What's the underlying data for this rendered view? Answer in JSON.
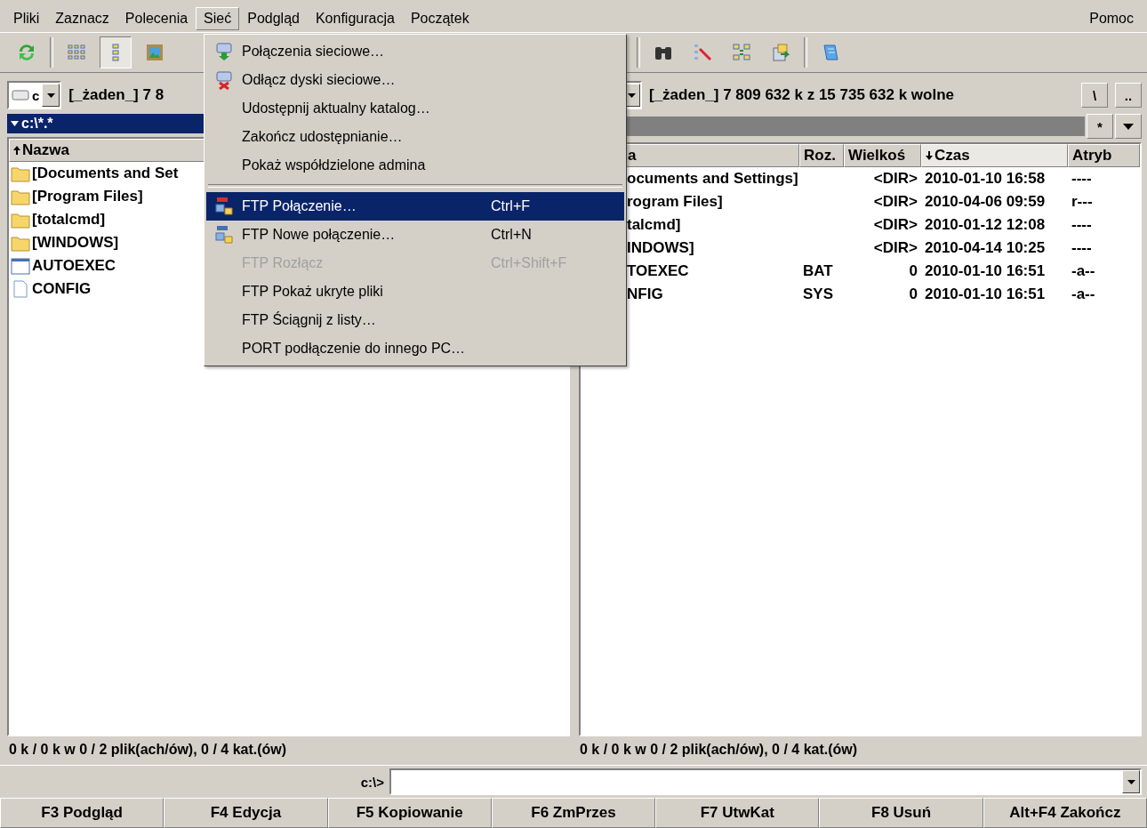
{
  "menu_bar": {
    "items": [
      {
        "label": "Pliki",
        "selected": false
      },
      {
        "label": "Zaznacz",
        "selected": false
      },
      {
        "label": "Polecenia",
        "selected": false
      },
      {
        "label": "Sieć",
        "selected": true
      },
      {
        "label": "Podgląd",
        "selected": false
      },
      {
        "label": "Konfiguracja",
        "selected": false
      },
      {
        "label": "Początek",
        "selected": false
      }
    ],
    "help": {
      "label": "Pomoc",
      "selected": false
    }
  },
  "toolbar": {
    "left": [
      {
        "kind": "refresh",
        "selected": false
      },
      {
        "kind": "separator"
      },
      {
        "kind": "brief",
        "selected": false
      },
      {
        "kind": "detailed",
        "selected": true
      },
      {
        "kind": "thumbnails",
        "selected": false
      }
    ],
    "right": [
      {
        "kind": "separator"
      },
      {
        "kind": "search",
        "selected": false
      },
      {
        "kind": "rename",
        "selected": false
      },
      {
        "kind": "sync",
        "selected": false
      },
      {
        "kind": "copy",
        "selected": false
      },
      {
        "kind": "separator"
      },
      {
        "kind": "notepad",
        "selected": false
      }
    ]
  },
  "dropdown": [
    {
      "kind": "connect",
      "label": "Połączenia sieciowe…",
      "disabled": false,
      "selected": false
    },
    {
      "kind": "disconnect",
      "label": "Odłącz dyski sieciowe…",
      "disabled": false,
      "selected": false
    },
    {
      "kind": "plain",
      "label": "Udostępnij aktualny katalog…",
      "disabled": false,
      "selected": false
    },
    {
      "kind": "plain",
      "label": "Zakończ udostępnianie…",
      "disabled": false,
      "selected": false
    },
    {
      "kind": "plain",
      "label": "Pokaż współdzielone admina",
      "disabled": false,
      "selected": false
    },
    {
      "kind": "separator"
    },
    {
      "kind": "ftp",
      "label": "FTP Połączenie…",
      "shortcut": "Ctrl+F",
      "disabled": false,
      "selected": true
    },
    {
      "kind": "url",
      "label": "FTP Nowe połączenie…",
      "shortcut": "Ctrl+N",
      "disabled": false,
      "selected": false
    },
    {
      "kind": "plain",
      "label": "FTP Rozłącz",
      "shortcut": "Ctrl+Shift+F",
      "disabled": true,
      "selected": false
    },
    {
      "kind": "plain",
      "label": "FTP Pokaż ukryte pliki",
      "disabled": false,
      "selected": false
    },
    {
      "kind": "plain",
      "label": "FTP Ściągnij z listy…",
      "disabled": false,
      "selected": false
    },
    {
      "kind": "plain",
      "label": "PORT podłączenie do innego PC…",
      "disabled": false,
      "selected": false
    }
  ],
  "left_panel": {
    "drive": "c",
    "drive_info": "[_żaden_] 7 8",
    "path": "c:\\*.*",
    "active": true,
    "column": {
      "label": "Nazwa",
      "sorted": true,
      "descending": false
    },
    "rows": [
      {
        "kind": "folder",
        "name": "[Documents and Set"
      },
      {
        "kind": "folder",
        "name": "[Program Files]"
      },
      {
        "kind": "folder",
        "name": "[totalcmd]"
      },
      {
        "kind": "folder",
        "name": "[WINDOWS]"
      },
      {
        "kind": "program",
        "name": "AUTOEXEC"
      },
      {
        "kind": "file",
        "name": "CONFIG"
      }
    ],
    "status": "0 k / 0 k w 0 / 2 plik(ach/ów), 0 / 4 kat.(ów)"
  },
  "right_panel": {
    "drive_info": "[_żaden_]  7 809 632 k z 15 735 632 k wolne",
    "root_button": "\\",
    "up_button": "..",
    "active": false,
    "filter_button": "*",
    "columns": [
      {
        "label": "a",
        "sorted": false
      },
      {
        "label": "Roz.",
        "sorted": false
      },
      {
        "label": "Wielkoś",
        "sorted": false
      },
      {
        "label": "Czas",
        "sorted": true,
        "descending": true
      },
      {
        "label": "Atryb",
        "sorted": false
      }
    ],
    "rows": [
      {
        "name": "ocuments and Settings]",
        "size": "<DIR>",
        "time": "2010-01-10 16:58",
        "attr": "----"
      },
      {
        "name": "rogram Files]",
        "size": "<DIR>",
        "time": "2010-04-06 09:59",
        "attr": "r---"
      },
      {
        "name": "talcmd]",
        "size": "<DIR>",
        "time": "2010-01-12 12:08",
        "attr": "----"
      },
      {
        "name": "INDOWS]",
        "size": "<DIR>",
        "time": "2010-04-14 10:25",
        "attr": "----"
      },
      {
        "name": "TOEXEC",
        "ext": "BAT",
        "size": "0",
        "time": "2010-01-10 16:51",
        "attr": "-a--"
      },
      {
        "name": "NFIG",
        "ext": "SYS",
        "size": "0",
        "time": "2010-01-10 16:51",
        "attr": "-a--"
      }
    ],
    "status": "0 k / 0 k w 0 / 2 plik(ach/ów), 0 / 4 kat.(ów)"
  },
  "command_line": {
    "prompt": "c:\\>"
  },
  "function_keys": [
    "F3 Podgląd",
    "F4 Edycja",
    "F5 Kopiowanie",
    "F6 ZmPrzes",
    "F7 UtwKat",
    "F8 Usuń",
    "Alt+F4 Zakończ"
  ]
}
